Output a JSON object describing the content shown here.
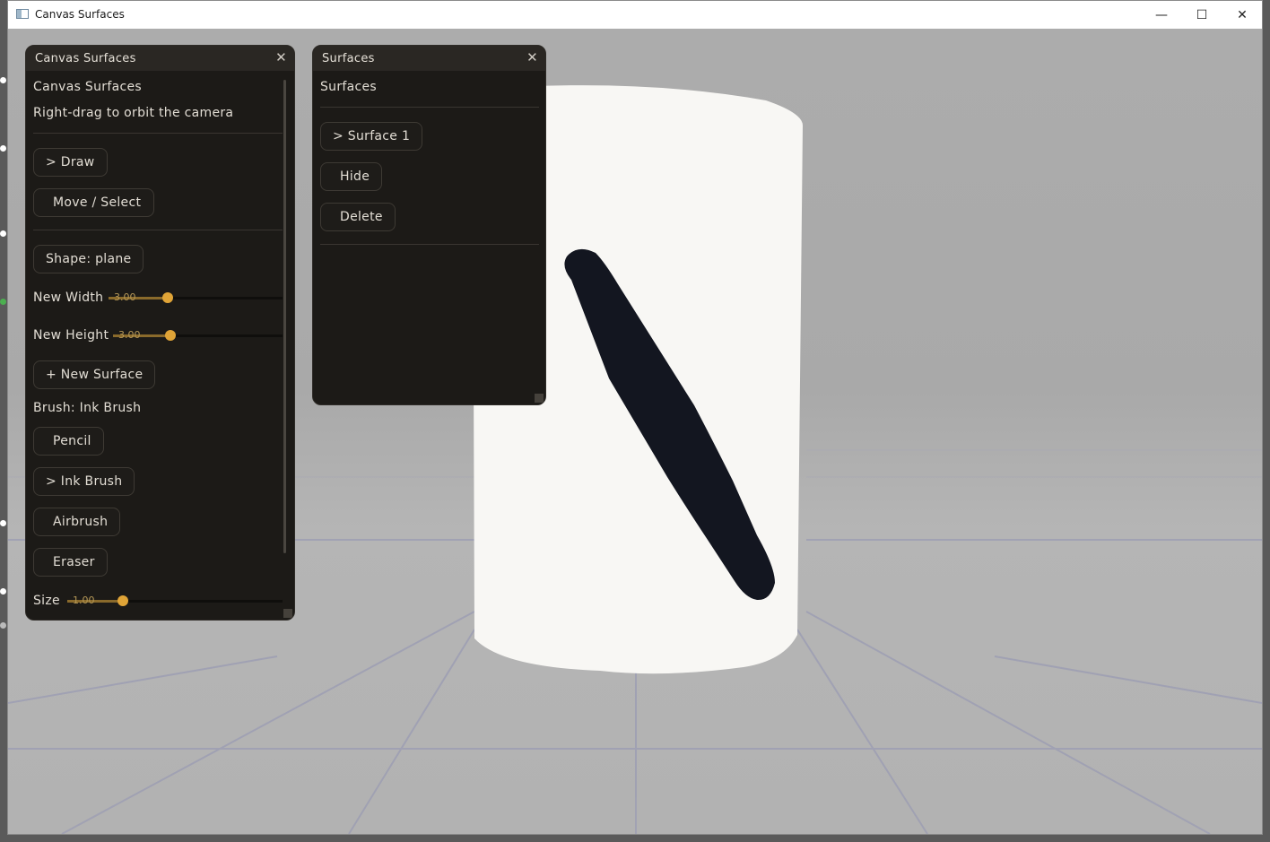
{
  "window": {
    "title": "Canvas Surfaces",
    "minimize_glyph": "—",
    "maximize_glyph": "☐",
    "close_glyph": "✕"
  },
  "canvas_panel": {
    "header": "Canvas Surfaces",
    "close": "✕",
    "heading": "Canvas Surfaces",
    "hint": "Right-drag to orbit the camera",
    "mode_draw": "> Draw",
    "mode_move": "Move / Select",
    "shape_button": "Shape: plane",
    "new_width": {
      "label": "New Width",
      "value": "3.00"
    },
    "new_height": {
      "label": "New Height",
      "value": "3.00"
    },
    "new_surface_button": "+ New Surface",
    "brush_label": "Brush: Ink Brush",
    "brushes": [
      "Pencil",
      "> Ink Brush",
      "Airbrush",
      "Eraser"
    ],
    "size": {
      "label": "Size",
      "value": "1.00"
    }
  },
  "surfaces_panel": {
    "header": "Surfaces",
    "close": "✕",
    "heading": "Surfaces",
    "surface_item": "> Surface 1",
    "hide_button": "Hide",
    "delete_button": "Delete"
  },
  "colors": {
    "accent": "#e0a437",
    "panel_bg": "#1c1a17",
    "canvas": "#f8f7f4",
    "stroke": "#131620"
  }
}
